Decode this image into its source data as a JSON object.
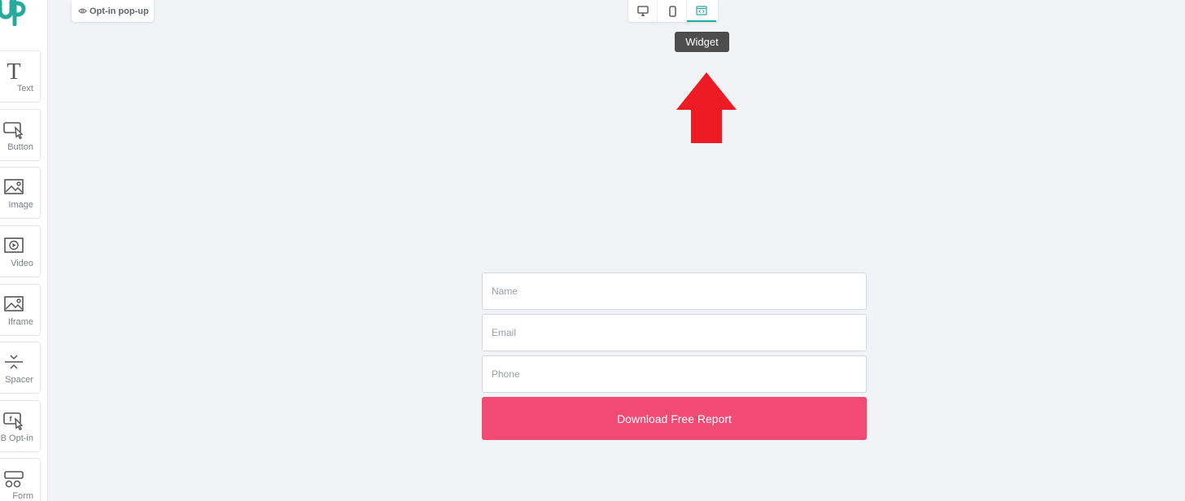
{
  "sidebar": {
    "tools": [
      {
        "label": "Text",
        "icon": "text-icon"
      },
      {
        "label": "Button",
        "icon": "button-icon"
      },
      {
        "label": "Image",
        "icon": "image-icon"
      },
      {
        "label": "Video",
        "icon": "video-icon"
      },
      {
        "label": "Iframe",
        "icon": "iframe-icon"
      },
      {
        "label": "Spacer",
        "icon": "spacer-icon"
      },
      {
        "label": "FB Opt-in",
        "icon": "fb-optin-icon"
      },
      {
        "label": "Form",
        "icon": "form-icon"
      }
    ]
  },
  "toolbar": {
    "optin_label": "Opt-in pop-up",
    "views": [
      "desktop-icon",
      "mobile-icon",
      "widget-icon"
    ],
    "active_view": "widget",
    "tooltip": "Widget"
  },
  "form": {
    "name_placeholder": "Name",
    "email_placeholder": "Email",
    "phone_placeholder": "Phone",
    "submit_label": "Download Free Report",
    "button_color": "#f14a75"
  },
  "colors": {
    "accent": "#27a99b",
    "annotation_arrow": "#ed1c24",
    "background": "#f2f3f7"
  }
}
